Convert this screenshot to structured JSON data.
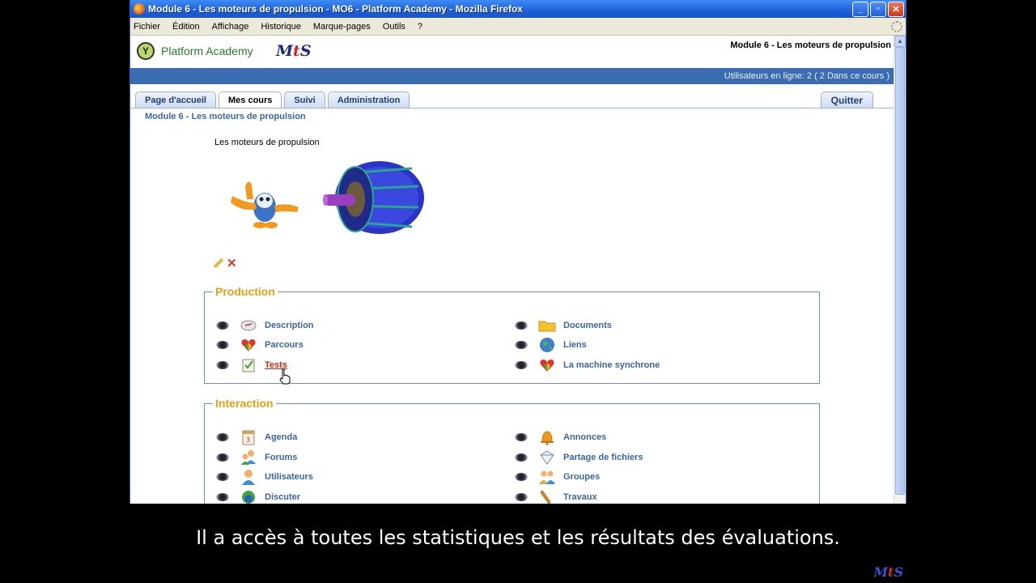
{
  "window": {
    "title": "Module 6 - Les moteurs de propulsion - MO6 - Platform Academy - Mozilla Firefox",
    "controls": [
      "_",
      "▫",
      "✕"
    ]
  },
  "menubar": {
    "items": [
      "Fichier",
      "Édition",
      "Affichage",
      "Historique",
      "Marque-pages",
      "Outils",
      "?"
    ]
  },
  "header": {
    "brand": "Platform Academy",
    "brand_initial": "Y",
    "partner_logo_m": "M",
    "partner_logo_t": "t",
    "partner_logo_s": "S",
    "course_title": "Module 6 - Les moteurs de propulsion",
    "online_users": "Utilisateurs en ligne:  2  ( 2 Dans ce cours )"
  },
  "tabs": [
    {
      "label": "Page d'accueil",
      "active": false
    },
    {
      "label": "Mes cours",
      "active": true
    },
    {
      "label": "Suivi",
      "active": false
    },
    {
      "label": "Administration",
      "active": false
    }
  ],
  "quit_label": "Quitter",
  "breadcrumb": "Module 6 - Les moteurs de propulsion",
  "intro_text": "Les moteurs de propulsion",
  "sections": [
    {
      "title": "Production",
      "left": [
        {
          "label": "Description",
          "icon": "description-icon",
          "hover": false
        },
        {
          "label": "Parcours",
          "icon": "parcours-icon",
          "hover": false
        },
        {
          "label": "Tests",
          "icon": "tests-icon",
          "hover": true
        }
      ],
      "right": [
        {
          "label": "Documents",
          "icon": "folder-icon",
          "hover": false
        },
        {
          "label": "Liens",
          "icon": "globe-icon",
          "hover": false
        },
        {
          "label": "La machine synchrone",
          "icon": "parcours-icon",
          "hover": false
        }
      ]
    },
    {
      "title": "Interaction",
      "left": [
        {
          "label": "Agenda",
          "icon": "agenda-icon",
          "hover": false
        },
        {
          "label": "Forums",
          "icon": "forums-icon",
          "hover": false
        },
        {
          "label": "Utilisateurs",
          "icon": "user-icon",
          "hover": false
        },
        {
          "label": "Discuter",
          "icon": "chat-icon",
          "hover": false
        }
      ],
      "right": [
        {
          "label": "Annonces",
          "icon": "bell-icon",
          "hover": false
        },
        {
          "label": "Partage de fichiers",
          "icon": "file-share-icon",
          "hover": false
        },
        {
          "label": "Groupes",
          "icon": "groups-icon",
          "hover": false
        },
        {
          "label": "Travaux",
          "icon": "pen-icon",
          "hover": false
        }
      ]
    }
  ],
  "subtitle": "Il a accès à toutes les statistiques et les résultats des évaluations.",
  "corner_logo_m": "M",
  "corner_logo_t": "t",
  "corner_logo_s": "S"
}
